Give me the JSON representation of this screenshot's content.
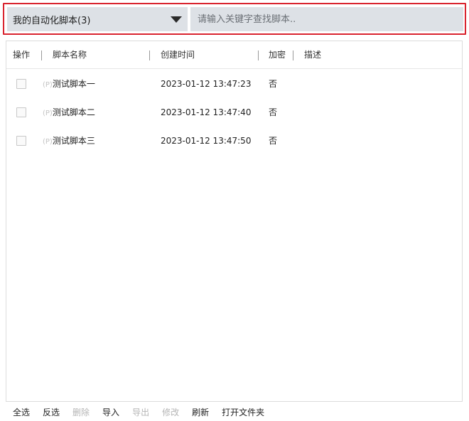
{
  "filter": {
    "selected": "我的自动化脚本(3)",
    "search_placeholder": "请输入关键字查找脚本.."
  },
  "table": {
    "headers": {
      "action": "操作",
      "name": "脚本名称",
      "created": "创建时间",
      "encrypted": "加密",
      "description": "描述"
    },
    "rows": [
      {
        "prefix": "(P)",
        "name": "测试脚本一",
        "created": "2023-01-12 13:47:23",
        "encrypted": "否",
        "description": ""
      },
      {
        "prefix": "(P)",
        "name": "测试脚本二",
        "created": "2023-01-12 13:47:40",
        "encrypted": "否",
        "description": ""
      },
      {
        "prefix": "(P)",
        "name": "测试脚本三",
        "created": "2023-01-12 13:47:50",
        "encrypted": "否",
        "description": ""
      }
    ]
  },
  "footer": {
    "select_all": "全选",
    "invert": "反选",
    "delete": "删除",
    "import": "导入",
    "export": "导出",
    "modify": "修改",
    "refresh": "刷新",
    "open_folder": "打开文件夹"
  },
  "colors": {
    "highlight_border": "#d9232e",
    "input_bg": "#dde1e6",
    "disabled_text": "#b5b5b5"
  }
}
